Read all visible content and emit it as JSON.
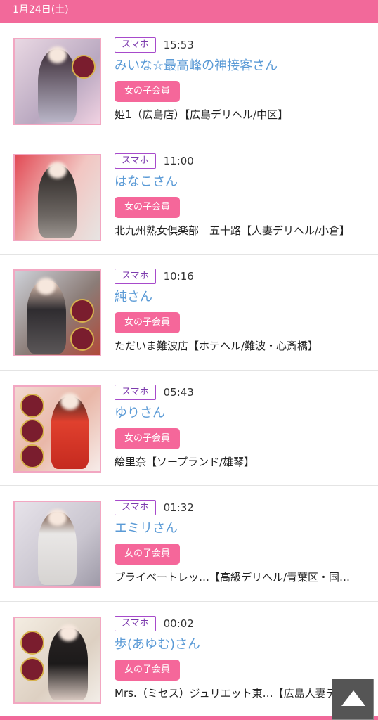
{
  "header": {
    "date": "1月24日(土)"
  },
  "entries": [
    {
      "device": "スマホ",
      "time": "15:53",
      "name": "みいな☆最高峰の神接客さん",
      "member": "女の子会員",
      "shop": "姫1（広島店）【広島デリヘル/中区】"
    },
    {
      "device": "スマホ",
      "time": "11:00",
      "name": "はなこさん",
      "member": "女の子会員",
      "shop": "北九州熟女倶楽部　五十路【人妻デリヘル/小倉】"
    },
    {
      "device": "スマホ",
      "time": "10:16",
      "name": "純さん",
      "member": "女の子会員",
      "shop": "ただいま難波店【ホテヘル/難波・心斎橋】"
    },
    {
      "device": "スマホ",
      "time": "05:43",
      "name": "ゆりさん",
      "member": "女の子会員",
      "shop": "絵里奈【ソープランド/雄琴】"
    },
    {
      "device": "スマホ",
      "time": "01:32",
      "name": "エミリさん",
      "member": "女の子会員",
      "shop": "プライベートレッ…【高級デリヘル/青葉区・国…"
    },
    {
      "device": "スマホ",
      "time": "00:02",
      "name": "歩(あゆむ)さん",
      "member": "女の子会員",
      "shop": "Mrs.（ミセス）ジュリエット東…【広島人妻デ…"
    }
  ],
  "colors": {
    "accent": "#f2699a",
    "name_link": "#5a9ad6",
    "device_border": "#a74acb"
  },
  "icons": {
    "scroll_top": "up-triangle-icon"
  }
}
